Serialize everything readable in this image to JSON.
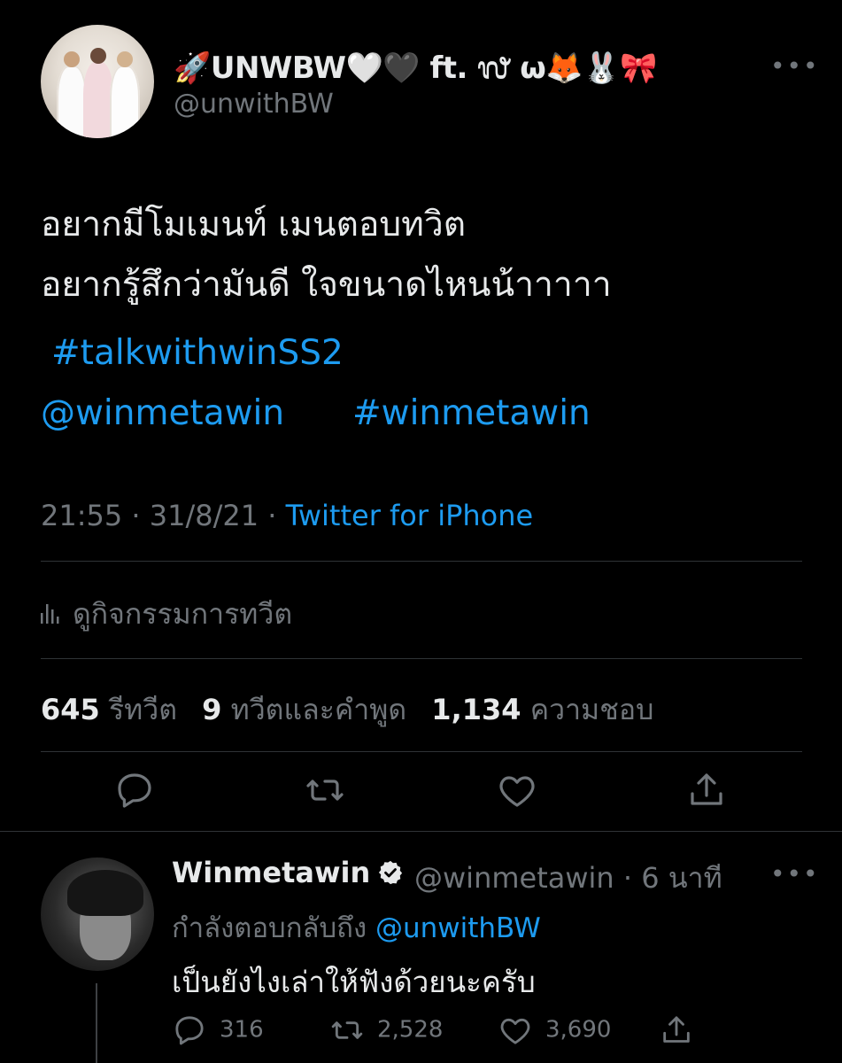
{
  "main_tweet": {
    "display_name": "🚀UNWBW🤍🖤 ft. ᭗ ω🦊🐰🎀",
    "handle": "@unwithBW",
    "text_line1": "อยากมีโมเมนท์ เมนตอบทวิต",
    "text_line2": "อยากรู้สึกว่ามันดี ใจขนาดไหนน้าาาาา",
    "hashtag1": "#talkwithwinSS2",
    "mention": "@winmetawin",
    "hashtag2": "#winmetawin",
    "timestamp": "21:55 · 31/8/21 · ",
    "source": "Twitter for iPhone",
    "activity_label": "ดูกิจกรรมการทวีต",
    "stats": {
      "retweets_count": "645",
      "retweets_label": "รีทวีต",
      "quotes_count": "9",
      "quotes_label": "ทวีตและคำพูด",
      "likes_count": "1,134",
      "likes_label": "ความชอบ"
    },
    "more_glyph": "•••"
  },
  "reply": {
    "display_name": "Winmetawin",
    "handle_time": "@winmetawin · 6 นาที",
    "replying_prefix": "กำลังตอบกลับถึง ",
    "replying_to": "@unwithBW",
    "text": "เป็นยังไงเล่าให้ฟังด้วยนะครับ",
    "replies": "316",
    "retweets": "2,528",
    "likes": "3,690",
    "more_glyph": "•••"
  },
  "colors": {
    "background": "#000000",
    "text": "#e7e9ea",
    "muted": "#71767b",
    "link": "#1d9bf0",
    "divider": "#2f3336"
  },
  "icons": [
    "reply-icon",
    "retweet-icon",
    "like-icon",
    "share-icon",
    "analytics-icon",
    "verified-icon",
    "more-icon"
  ]
}
